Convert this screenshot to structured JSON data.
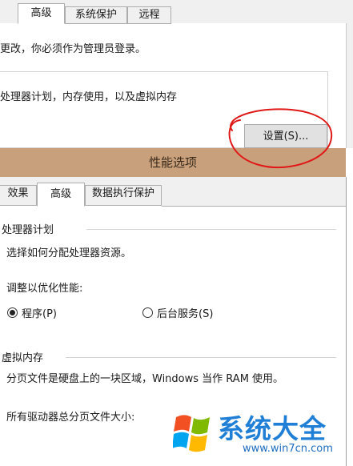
{
  "system_properties": {
    "tabs": [
      "高级",
      "系统保护",
      "远程"
    ],
    "selected_tab": "高级",
    "admin_note": "更改，你必须作为管理员登录。",
    "performance_description": "处理器计划，内存使用，以及虚拟内存",
    "settings_button": "设置(S)..."
  },
  "performance_options": {
    "title": "性能选项",
    "tabs": [
      "效果",
      "高级",
      "数据执行保护"
    ],
    "selected_tab": "高级",
    "processor_section": {
      "heading": "处理器计划",
      "description": "选择如何分配处理器资源。",
      "adjust_label": "调整以优化性能:",
      "options": [
        {
          "label": "程序(P)",
          "checked": true
        },
        {
          "label": "后台服务(S)",
          "checked": false
        }
      ]
    },
    "virtual_memory_section": {
      "heading": "虚拟内存",
      "description": "分页文件是硬盘上的一块区域，Windows 当作 RAM 使用。",
      "total_label": "所有驱动器总分页文件大小:"
    }
  },
  "watermark": {
    "brand": "系统大全",
    "url": "www.win7cn.com"
  },
  "colors": {
    "titlebar": "#c9a07c",
    "annotation_circle": "#e01818",
    "watermark_blue": "#1f7fd6"
  }
}
